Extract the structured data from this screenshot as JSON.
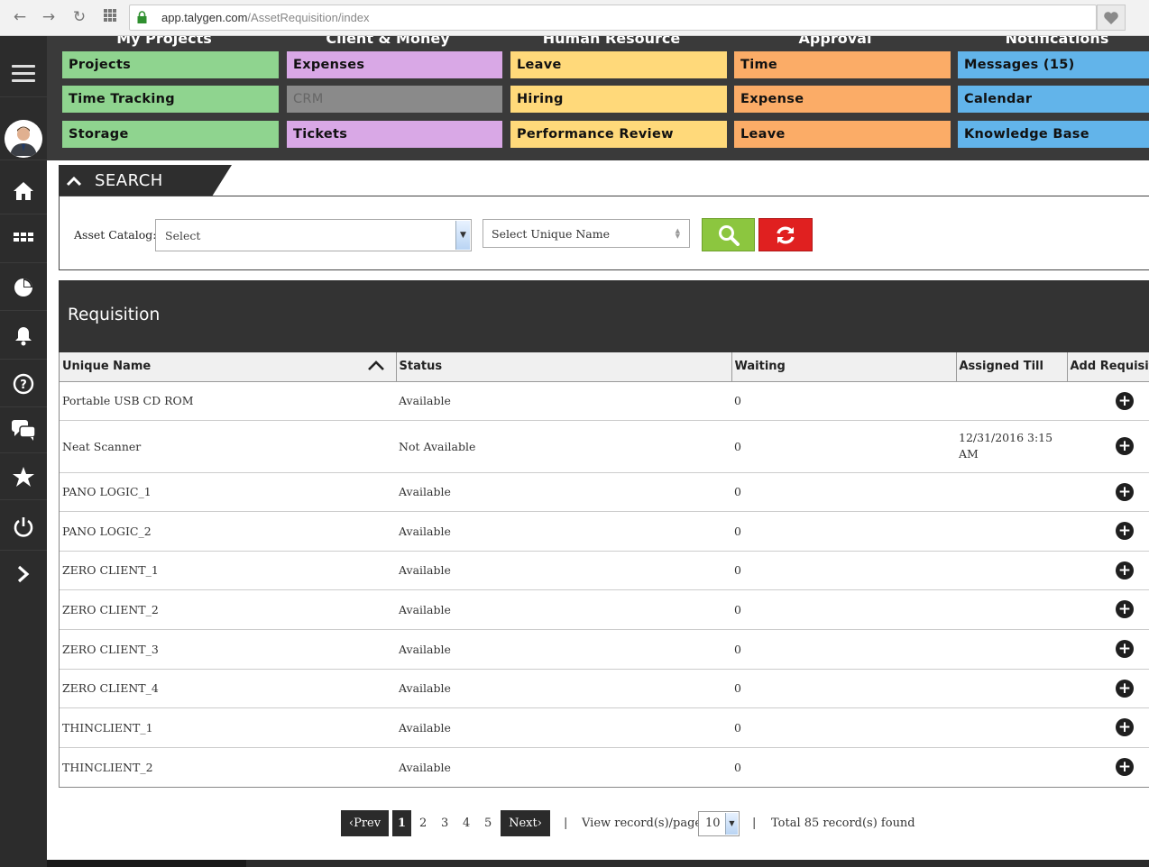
{
  "browser": {
    "url_host": "app.talygen.com",
    "url_path": "/AssetRequisition/index"
  },
  "sidebar": {
    "items": [
      "menu-icon",
      "avatar",
      "home-icon",
      "apps-icon",
      "chart-icon",
      "bell-icon",
      "help-icon",
      "chat-icon",
      "star-icon",
      "power-icon",
      "chevron-right-icon"
    ]
  },
  "modules": {
    "columns": [
      {
        "heading": "My Projects",
        "items": [
          "Projects",
          "Time Tracking",
          "Storage"
        ]
      },
      {
        "heading": "Client & Money",
        "items": [
          "Expenses",
          "CRM",
          "Tickets"
        ]
      },
      {
        "heading": "Human Resource",
        "items": [
          "Leave",
          "Hiring",
          "Performance Review"
        ]
      },
      {
        "heading": "Approval",
        "items": [
          "Time",
          "Expense",
          "Leave"
        ]
      },
      {
        "heading": "Notifications",
        "items": [
          "Messages (15)",
          "Calendar",
          "Knowledge Base"
        ]
      }
    ],
    "colors": {
      "green": "#8fd48f",
      "purple": "#d9a8e6",
      "yellow": "#ffd97a",
      "orange": "#fbac67",
      "blue": "#62b4ea",
      "disabled": "#8a8a8a"
    }
  },
  "search": {
    "title": "SEARCH",
    "asset_catalog_label": "Asset Catalog:",
    "asset_catalog_value": "Select",
    "unique_name_value": "Select Unique Name"
  },
  "requisition": {
    "title": "Requisition",
    "columns": [
      "Unique Name",
      "Status",
      "Waiting",
      "Assigned Till",
      "Add Requisition"
    ],
    "rows": [
      {
        "name": "Portable USB CD ROM",
        "status": "Available",
        "waiting": "0",
        "assigned_till": ""
      },
      {
        "name": "Neat Scanner",
        "status": "Not Available",
        "waiting": "0",
        "assigned_till": "12/31/2016 3:15 AM"
      },
      {
        "name": "PANO LOGIC_1",
        "status": "Available",
        "waiting": "0",
        "assigned_till": ""
      },
      {
        "name": "PANO LOGIC_2",
        "status": "Available",
        "waiting": "0",
        "assigned_till": ""
      },
      {
        "name": "ZERO CLIENT_1",
        "status": "Available",
        "waiting": "0",
        "assigned_till": ""
      },
      {
        "name": "ZERO CLIENT_2",
        "status": "Available",
        "waiting": "0",
        "assigned_till": ""
      },
      {
        "name": "ZERO CLIENT_3",
        "status": "Available",
        "waiting": "0",
        "assigned_till": ""
      },
      {
        "name": "ZERO CLIENT_4",
        "status": "Available",
        "waiting": "0",
        "assigned_till": ""
      },
      {
        "name": "THINCLIENT_1",
        "status": "Available",
        "waiting": "0",
        "assigned_till": ""
      },
      {
        "name": "THINCLIENT_2",
        "status": "Available",
        "waiting": "0",
        "assigned_till": ""
      }
    ]
  },
  "pagination": {
    "prev": "Prev",
    "next": "Next",
    "pages": [
      "1",
      "2",
      "3",
      "4",
      "5"
    ],
    "current": "1",
    "separator": "|",
    "per_page_label": "View record(s)/page",
    "per_page_value": "10",
    "total_text": "Total 85 record(s) found"
  }
}
